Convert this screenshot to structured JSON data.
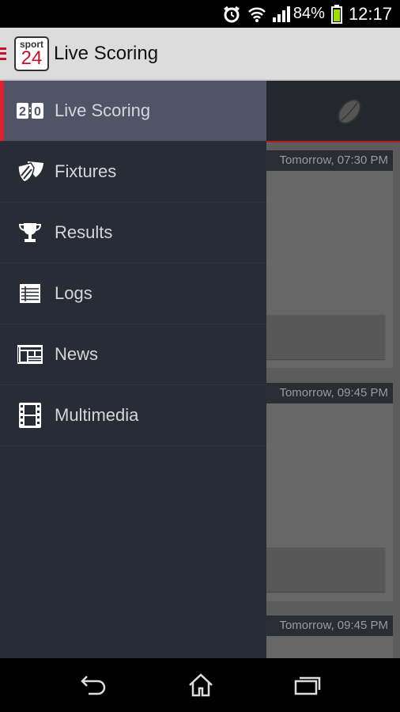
{
  "status_bar": {
    "battery": "84%",
    "time": "12:17",
    "icons": [
      "alarm-icon",
      "wifi-icon",
      "signal-icon",
      "battery-icon"
    ],
    "battery_color": "#9be000"
  },
  "app_bar": {
    "logo_top": "sport",
    "logo_bottom": "24",
    "title": "Live Scoring"
  },
  "drawer": {
    "items": [
      {
        "label": "Live Scoring",
        "icon": "scoreboard-icon",
        "active": true
      },
      {
        "label": "Fixtures",
        "icon": "shield-icon"
      },
      {
        "label": "Results",
        "icon": "trophy-icon"
      },
      {
        "label": "Logs",
        "icon": "table-icon"
      },
      {
        "label": "News",
        "icon": "newspaper-icon"
      },
      {
        "label": "Multimedia",
        "icon": "film-icon"
      }
    ]
  },
  "content": {
    "tab_icon": "rugby-ball-icon",
    "matches": [
      {
        "time": "Tomorrow, 07:30 PM"
      },
      {
        "time": "Tomorrow, 09:45 PM"
      },
      {
        "time": "Tomorrow, 09:45 PM"
      }
    ]
  },
  "colors": {
    "accent": "#e0202a",
    "drawer_bg": "#282c36",
    "active_bg": "#4f5567"
  }
}
